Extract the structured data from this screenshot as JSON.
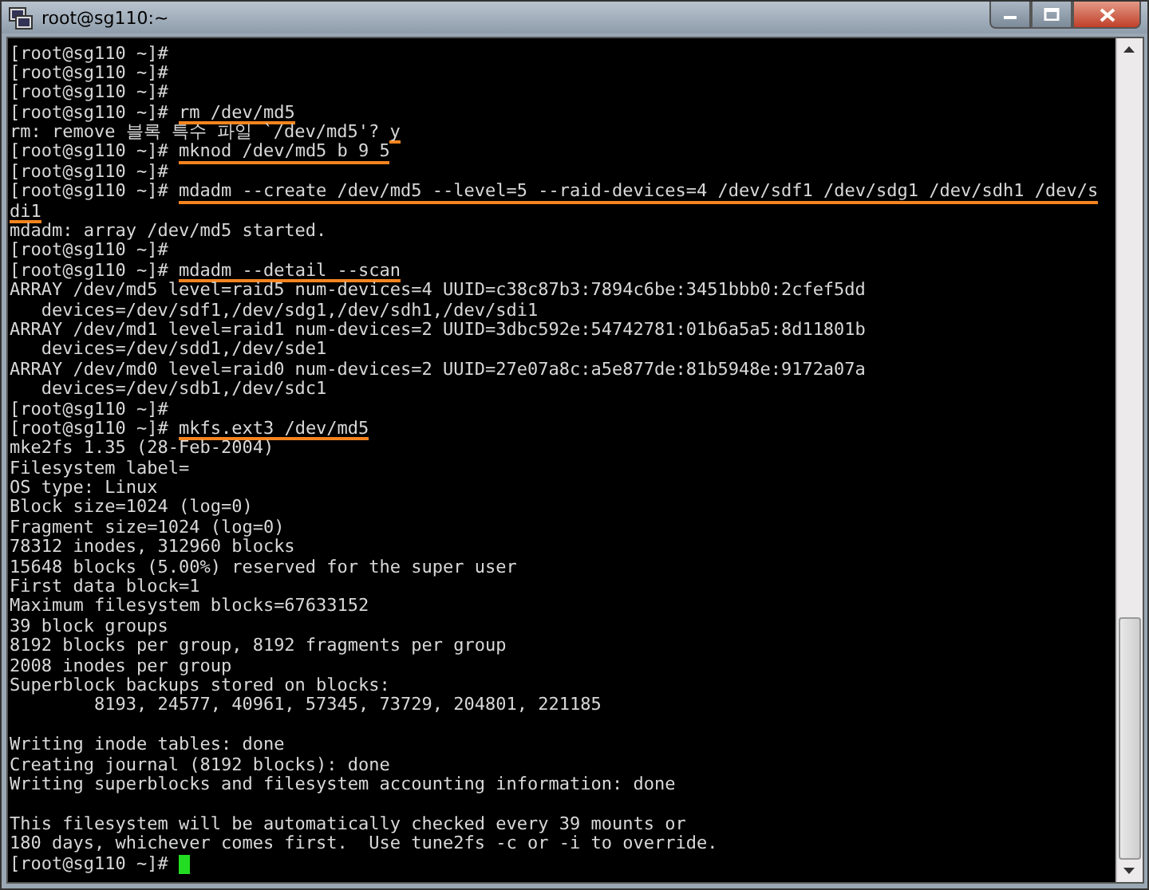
{
  "window": {
    "title": "root@sg110:~"
  },
  "lines": [
    {
      "kind": "text",
      "cursor": false,
      "segments": [
        {
          "text": "[root@sg110 ~]#",
          "underlined": false
        }
      ]
    },
    {
      "kind": "text",
      "cursor": false,
      "segments": [
        {
          "text": "[root@sg110 ~]#",
          "underlined": false
        }
      ]
    },
    {
      "kind": "text",
      "cursor": false,
      "segments": [
        {
          "text": "[root@sg110 ~]#",
          "underlined": false
        }
      ]
    },
    {
      "kind": "text",
      "cursor": false,
      "segments": [
        {
          "text": "[root@sg110 ~]# ",
          "underlined": false
        },
        {
          "text": "rm /dev/md5",
          "underlined": true
        }
      ]
    },
    {
      "kind": "text",
      "cursor": false,
      "segments": [
        {
          "text": "rm: remove 블록 특수 파일 `/dev/md5'? ",
          "underlined": false
        },
        {
          "text": "y",
          "underlined": true
        }
      ]
    },
    {
      "kind": "text",
      "cursor": false,
      "segments": [
        {
          "text": "[root@sg110 ~]# ",
          "underlined": false
        },
        {
          "text": "mknod /dev/md5 b 9 5",
          "underlined": true
        }
      ]
    },
    {
      "kind": "text",
      "cursor": false,
      "segments": [
        {
          "text": "[root@sg110 ~]#",
          "underlined": false
        }
      ]
    },
    {
      "kind": "text",
      "cursor": false,
      "segments": [
        {
          "text": "[root@sg110 ~]# ",
          "underlined": false
        },
        {
          "text": "mdadm --create /dev/md5 --level=5 --raid-devices=4 /dev/sdf1 /dev/sdg1 /dev/sdh1 /dev/s",
          "underlined": true
        }
      ]
    },
    {
      "kind": "text",
      "cursor": false,
      "segments": [
        {
          "text": "di1",
          "underlined": true
        }
      ]
    },
    {
      "kind": "text",
      "cursor": false,
      "segments": [
        {
          "text": "mdadm: array /dev/md5 started.",
          "underlined": false
        }
      ]
    },
    {
      "kind": "text",
      "cursor": false,
      "segments": [
        {
          "text": "[root@sg110 ~]#",
          "underlined": false
        }
      ]
    },
    {
      "kind": "text",
      "cursor": false,
      "segments": [
        {
          "text": "[root@sg110 ~]# ",
          "underlined": false
        },
        {
          "text": "mdadm --detail --scan",
          "underlined": true
        }
      ]
    },
    {
      "kind": "text",
      "cursor": false,
      "segments": [
        {
          "text": "ARRAY /dev/md5 level=raid5 num-devices=4 UUID=c38c87b3:7894c6be:3451bbb0:2cfef5dd",
          "underlined": false
        }
      ]
    },
    {
      "kind": "text",
      "cursor": false,
      "segments": [
        {
          "text": "   devices=/dev/sdf1,/dev/sdg1,/dev/sdh1,/dev/sdi1",
          "underlined": false
        }
      ]
    },
    {
      "kind": "text",
      "cursor": false,
      "segments": [
        {
          "text": "ARRAY /dev/md1 level=raid1 num-devices=2 UUID=3dbc592e:54742781:01b6a5a5:8d11801b",
          "underlined": false
        }
      ]
    },
    {
      "kind": "text",
      "cursor": false,
      "segments": [
        {
          "text": "   devices=/dev/sdd1,/dev/sde1",
          "underlined": false
        }
      ]
    },
    {
      "kind": "text",
      "cursor": false,
      "segments": [
        {
          "text": "ARRAY /dev/md0 level=raid0 num-devices=2 UUID=27e07a8c:a5e877de:81b5948e:9172a07a",
          "underlined": false
        }
      ]
    },
    {
      "kind": "text",
      "cursor": false,
      "segments": [
        {
          "text": "   devices=/dev/sdb1,/dev/sdc1",
          "underlined": false
        }
      ]
    },
    {
      "kind": "text",
      "cursor": false,
      "segments": [
        {
          "text": "[root@sg110 ~]#",
          "underlined": false
        }
      ]
    },
    {
      "kind": "text",
      "cursor": false,
      "segments": [
        {
          "text": "[root@sg110 ~]# ",
          "underlined": false
        },
        {
          "text": "mkfs.ext3 /dev/md5",
          "underlined": true
        }
      ]
    },
    {
      "kind": "text",
      "cursor": false,
      "segments": [
        {
          "text": "mke2fs 1.35 (28-Feb-2004)",
          "underlined": false
        }
      ]
    },
    {
      "kind": "text",
      "cursor": false,
      "segments": [
        {
          "text": "Filesystem label=",
          "underlined": false
        }
      ]
    },
    {
      "kind": "text",
      "cursor": false,
      "segments": [
        {
          "text": "OS type: Linux",
          "underlined": false
        }
      ]
    },
    {
      "kind": "text",
      "cursor": false,
      "segments": [
        {
          "text": "Block size=1024 (log=0)",
          "underlined": false
        }
      ]
    },
    {
      "kind": "text",
      "cursor": false,
      "segments": [
        {
          "text": "Fragment size=1024 (log=0)",
          "underlined": false
        }
      ]
    },
    {
      "kind": "text",
      "cursor": false,
      "segments": [
        {
          "text": "78312 inodes, 312960 blocks",
          "underlined": false
        }
      ]
    },
    {
      "kind": "text",
      "cursor": false,
      "segments": [
        {
          "text": "15648 blocks (5.00%) reserved for the super user",
          "underlined": false
        }
      ]
    },
    {
      "kind": "text",
      "cursor": false,
      "segments": [
        {
          "text": "First data block=1",
          "underlined": false
        }
      ]
    },
    {
      "kind": "text",
      "cursor": false,
      "segments": [
        {
          "text": "Maximum filesystem blocks=67633152",
          "underlined": false
        }
      ]
    },
    {
      "kind": "text",
      "cursor": false,
      "segments": [
        {
          "text": "39 block groups",
          "underlined": false
        }
      ]
    },
    {
      "kind": "text",
      "cursor": false,
      "segments": [
        {
          "text": "8192 blocks per group, 8192 fragments per group",
          "underlined": false
        }
      ]
    },
    {
      "kind": "text",
      "cursor": false,
      "segments": [
        {
          "text": "2008 inodes per group",
          "underlined": false
        }
      ]
    },
    {
      "kind": "text",
      "cursor": false,
      "segments": [
        {
          "text": "Superblock backups stored on blocks:",
          "underlined": false
        }
      ]
    },
    {
      "kind": "text",
      "cursor": false,
      "segments": [
        {
          "text": "        8193, 24577, 40961, 57345, 73729, 204801, 221185",
          "underlined": false
        }
      ]
    },
    {
      "kind": "blank"
    },
    {
      "kind": "text",
      "cursor": false,
      "segments": [
        {
          "text": "Writing inode tables: done",
          "underlined": false
        }
      ]
    },
    {
      "kind": "text",
      "cursor": false,
      "segments": [
        {
          "text": "Creating journal (8192 blocks): done",
          "underlined": false
        }
      ]
    },
    {
      "kind": "text",
      "cursor": false,
      "segments": [
        {
          "text": "Writing superblocks and filesystem accounting information: done",
          "underlined": false
        }
      ]
    },
    {
      "kind": "blank"
    },
    {
      "kind": "text",
      "cursor": false,
      "segments": [
        {
          "text": "This filesystem will be automatically checked every 39 mounts or",
          "underlined": false
        }
      ]
    },
    {
      "kind": "text",
      "cursor": false,
      "segments": [
        {
          "text": "180 days, whichever comes first.  Use tune2fs -c or -i to override.",
          "underlined": false
        }
      ]
    },
    {
      "kind": "text",
      "cursor": true,
      "segments": [
        {
          "text": "[root@sg110 ~]# ",
          "underlined": false
        }
      ]
    }
  ]
}
